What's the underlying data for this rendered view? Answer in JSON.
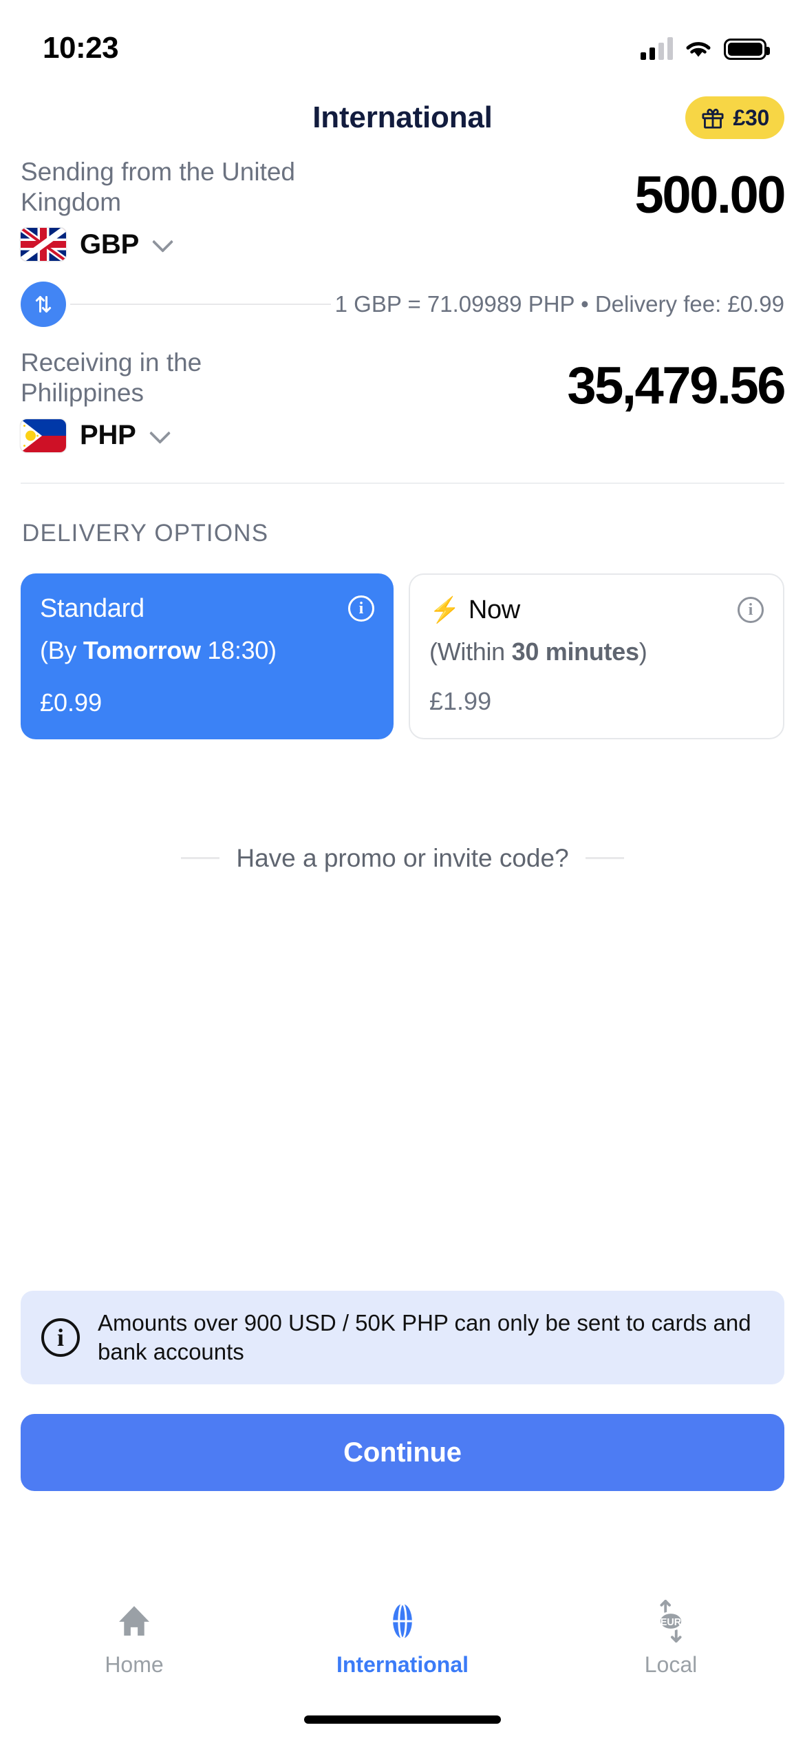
{
  "status_bar": {
    "time": "10:23",
    "signal_icon": "cellular-signal-icon",
    "wifi_icon": "wifi-icon",
    "battery_icon": "battery-full-icon"
  },
  "header": {
    "title": "International",
    "gift_badge": {
      "icon": "gift-icon",
      "amount": "£30"
    }
  },
  "converter": {
    "send": {
      "label": "Sending from the United Kingdom",
      "currency_code": "GBP",
      "flag": "uk-flag-icon",
      "amount": "500.00"
    },
    "swap_icon": "swap-vertical-arrows-icon",
    "rate_text": "1 GBP = 71.09989 PHP • Delivery fee: £0.99",
    "receive": {
      "label": "Receiving in the Philippines",
      "currency_code": "PHP",
      "flag": "philippines-flag-icon",
      "amount": "35,479.56"
    }
  },
  "delivery": {
    "section_title": "DELIVERY OPTIONS",
    "options": [
      {
        "title": "Standard",
        "bolt": "",
        "sub_prefix": "(By ",
        "sub_bold": "Tomorrow",
        "sub_suffix": " 18:30)",
        "price": "£0.99",
        "selected": true,
        "info_icon": "info-icon"
      },
      {
        "title": "Now",
        "bolt": "⚡",
        "sub_prefix": "(Within ",
        "sub_bold": "30 minutes",
        "sub_suffix": ")",
        "price": "£1.99",
        "selected": false,
        "info_icon": "info-icon"
      }
    ]
  },
  "promo": {
    "text": "Have a promo or invite code?"
  },
  "banner": {
    "icon": "info-circle-icon",
    "text": "Amounts over 900 USD / 50K PHP can only be sent to cards and bank accounts"
  },
  "continue_button": {
    "label": "Continue"
  },
  "tabbar": {
    "items": [
      {
        "label": "Home",
        "icon": "home-icon",
        "active": false
      },
      {
        "label": "International",
        "icon": "globe-icon",
        "active": true
      },
      {
        "label": "Local",
        "icon": "eur-exchange-icon",
        "active": false
      }
    ]
  },
  "colors": {
    "accent_blue": "#3b82f6",
    "cta_blue": "#4d7cf3",
    "badge_yellow": "#f7d645",
    "banner_blue": "#e3eafc",
    "navy": "#121c3e",
    "muted_gray": "#6b7280"
  }
}
